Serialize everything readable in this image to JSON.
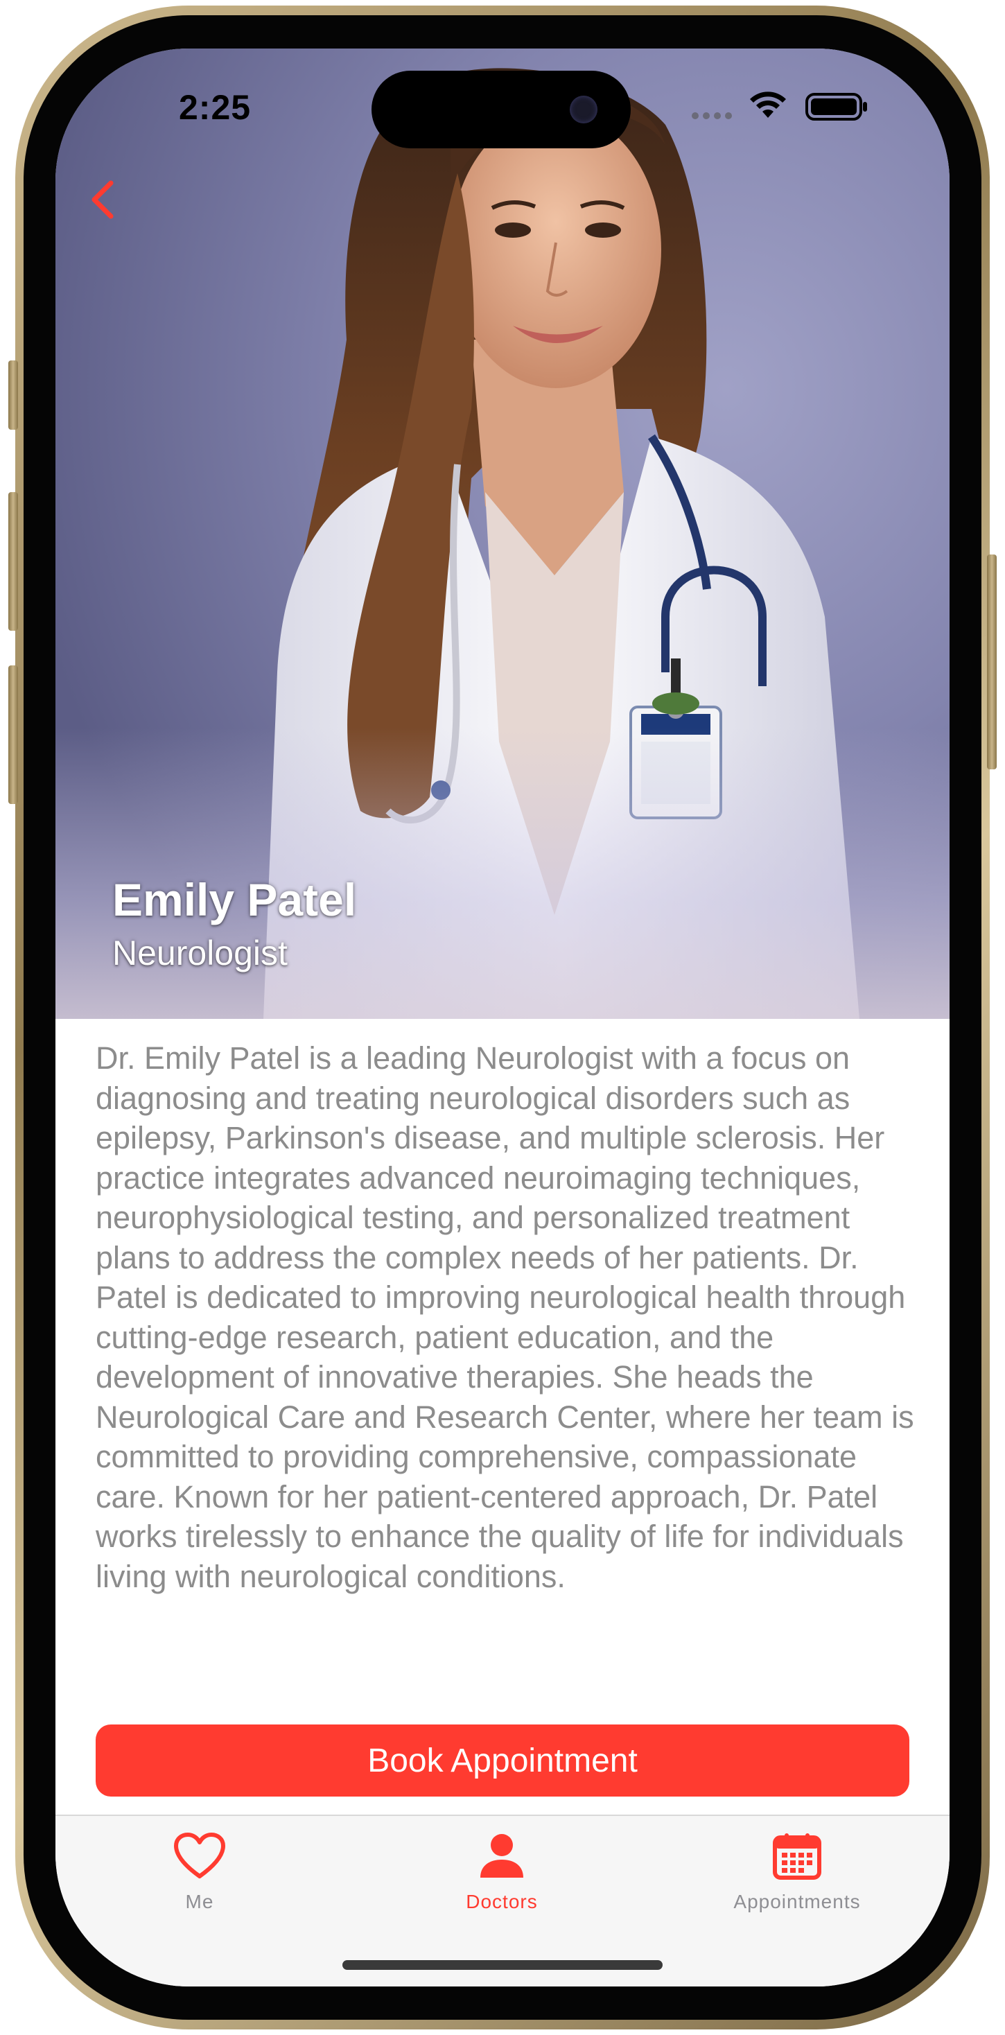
{
  "status_bar": {
    "time": "2:25"
  },
  "doctor": {
    "name": "Emily Patel",
    "specialty": "Neurologist",
    "bio": "Dr. Emily Patel is a leading Neurologist with a focus on diagnosing and treating neurological disorders such as epilepsy, Parkinson's disease, and multiple sclerosis. Her practice integrates advanced neuroimaging techniques, neurophysiological testing, and personalized treatment plans to address the complex needs of her patients. Dr. Patel is dedicated to improving neurological health through cutting-edge research, patient education, and the development of innovative therapies. She heads the Neurological Care and Research Center, where her team is committed to providing comprehensive, compassionate care. Known for her patient-centered approach, Dr. Patel works tirelessly to enhance the quality of life for individuals living with neurological conditions."
  },
  "actions": {
    "book_label": "Book Appointment"
  },
  "tabbar": {
    "active": "Doctors",
    "items": [
      {
        "label": "Me",
        "icon": "heart-icon"
      },
      {
        "label": "Doctors",
        "icon": "person-icon"
      },
      {
        "label": "Appointments",
        "icon": "calendar-icon"
      }
    ]
  },
  "colors": {
    "accent": "#ff3b30",
    "inactive_tab": "#8e8e93",
    "bio_text": "#8c8c8c",
    "tabbar_bg": "#f6f6f6"
  }
}
